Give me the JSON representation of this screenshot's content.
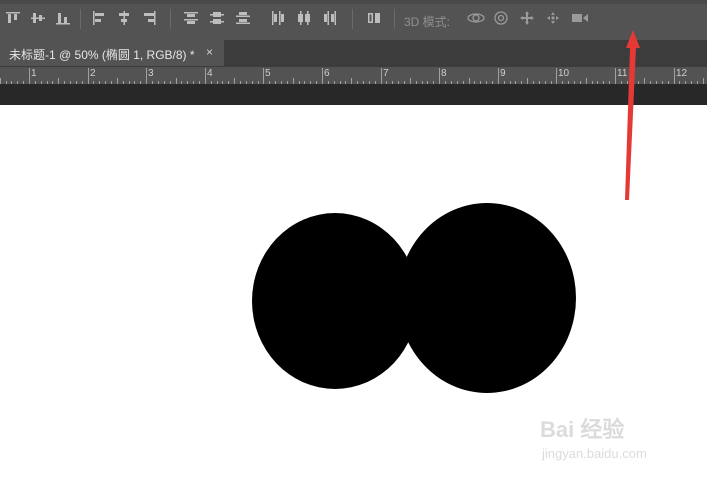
{
  "toolbar": {
    "mode_label": "3D 模式:",
    "icons": [
      "align-top-edges-icon",
      "align-vertical-centers-icon",
      "align-bottom-edges-icon",
      "align-left-edges-icon",
      "align-horizontal-centers-icon",
      "align-right-edges-icon",
      "distribute-top-icon",
      "distribute-vertical-centers-icon",
      "distribute-bottom-icon",
      "distribute-left-icon",
      "distribute-horizontal-centers-icon",
      "distribute-right-icon",
      "auto-align-layers-icon",
      "rotate-3d-icon",
      "roll-3d-icon",
      "drag-3d-icon",
      "slide-3d-icon",
      "scale-3d-icon"
    ]
  },
  "document_tab": {
    "title": "未标题-1 @ 50% (椭圆 1, RGB/8) *",
    "close": "×"
  },
  "ruler": {
    "labels": [
      "1",
      "2",
      "3",
      "4",
      "5",
      "6",
      "7",
      "8",
      "9",
      "10",
      "11",
      "12"
    ]
  },
  "canvas": {
    "shapes": [
      "ellipse",
      "ellipse"
    ],
    "fill_color": "#000000",
    "background_color": "#ffffff"
  },
  "annotation": {
    "arrow_color": "#e53935"
  },
  "watermark": {
    "brand": "Bai 经验",
    "url": "jingyan.baidu.com"
  }
}
